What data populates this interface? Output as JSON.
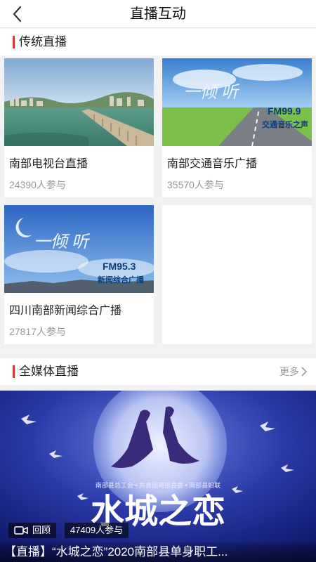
{
  "header": {
    "title": "直播互动"
  },
  "traditional": {
    "section_title": "传统直播",
    "items": [
      {
        "name": "南部电视台直播",
        "participants": "24390人参与"
      },
      {
        "name": "南部交通音乐广播",
        "participants": "35570人参与",
        "logo_text": "FM99.9",
        "logo_sub": "交通音乐之声",
        "brand_text": "一倾 听"
      },
      {
        "name": "四川南部新闻综合广播",
        "participants": "27817人参与",
        "logo_text": "FM95.3",
        "logo_sub": "新闻综合广播",
        "brand_text": "一倾 听"
      }
    ]
  },
  "all_media": {
    "section_title": "全媒体直播",
    "more_label": "更多",
    "featured": {
      "replay_label": "回顾",
      "participants": "47409人参与",
      "poster_title": "水城之恋",
      "poster_subtitle": "南部县总工会 • 共青团南部县委 • 南部县妇联",
      "title": "【直播】“水城之恋”2020南部县单身职工..."
    }
  },
  "colors": {
    "accent": "#d63a35",
    "background": "#f2f2f2",
    "secondary_text": "#999999"
  }
}
